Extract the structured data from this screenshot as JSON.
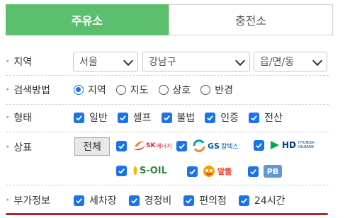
{
  "tabs": [
    {
      "label": "주유소",
      "active": true
    },
    {
      "label": "충전소",
      "active": false
    }
  ],
  "region": {
    "label": "지역",
    "city": "서울",
    "district": "강남구",
    "dong": "읍/면/동"
  },
  "search_method": {
    "label": "검색방법",
    "options": [
      {
        "label": "지역",
        "selected": true
      },
      {
        "label": "지도",
        "selected": false
      },
      {
        "label": "상호",
        "selected": false
      },
      {
        "label": "반경",
        "selected": false
      }
    ]
  },
  "type": {
    "label": "형태",
    "options": [
      {
        "label": "일반",
        "checked": true
      },
      {
        "label": "셀프",
        "checked": true
      },
      {
        "label": "불법",
        "checked": true
      },
      {
        "label": "인증",
        "checked": true
      },
      {
        "label": "전산",
        "checked": true
      }
    ]
  },
  "brand": {
    "label": "상표",
    "all_button": "전체",
    "logos": [
      {
        "name": "SK",
        "text": "에너지",
        "checked": true
      },
      {
        "name": "GS",
        "text": "칼텍스",
        "checked": true
      },
      {
        "name": "HD",
        "text": "HYUNDAI OILBANK",
        "checked": true
      },
      {
        "name": "S-OIL",
        "text": "S-OIL",
        "checked": true
      },
      {
        "name": "알뜰",
        "text": "알뜰",
        "checked": true
      },
      {
        "name": "PB",
        "text": "PB",
        "checked": true
      }
    ]
  },
  "extra": {
    "label": "부가정보",
    "options": [
      {
        "label": "세차장",
        "checked": true
      },
      {
        "label": "경정비",
        "checked": true
      },
      {
        "label": "편의점",
        "checked": true
      },
      {
        "label": "24시간",
        "checked": true
      }
    ]
  },
  "colors": {
    "tab_active": "#5cbf6e",
    "checkbox": "#1a73e8",
    "label_dot": "#f08a3c",
    "bottom_line": "#b3262d"
  }
}
